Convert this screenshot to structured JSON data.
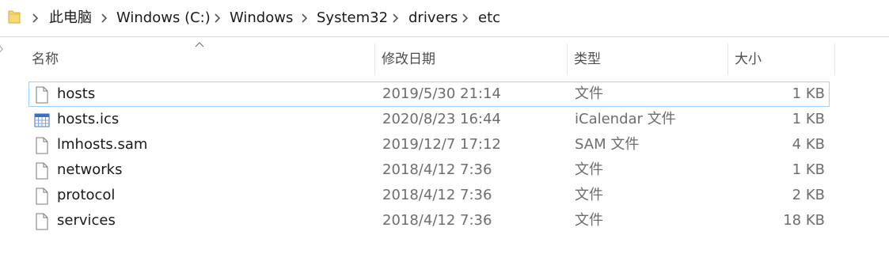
{
  "breadcrumb": {
    "items": [
      {
        "label": "此电脑"
      },
      {
        "label": "Windows (C:)"
      },
      {
        "label": "Windows"
      },
      {
        "label": "System32"
      },
      {
        "label": "drivers"
      },
      {
        "label": "etc"
      }
    ]
  },
  "columns": {
    "name": "名称",
    "date": "修改日期",
    "type": "类型",
    "size": "大小",
    "sort_indicator": "sort-ascending-icon"
  },
  "files": [
    {
      "name": "hosts",
      "modified": "2019/5/30 21:14",
      "type": "文件",
      "size": "1 KB",
      "icon": "document-icon",
      "focused": true
    },
    {
      "name": "hosts.ics",
      "modified": "2020/8/23 16:44",
      "type": "iCalendar 文件",
      "size": "1 KB",
      "icon": "calendar-file-icon",
      "focused": false
    },
    {
      "name": "lmhosts.sam",
      "modified": "2019/12/7 17:12",
      "type": "SAM 文件",
      "size": "4 KB",
      "icon": "document-icon",
      "focused": false
    },
    {
      "name": "networks",
      "modified": "2018/4/12 7:36",
      "type": "文件",
      "size": "1 KB",
      "icon": "document-icon",
      "focused": false
    },
    {
      "name": "protocol",
      "modified": "2018/4/12 7:36",
      "type": "文件",
      "size": "2 KB",
      "icon": "document-icon",
      "focused": false
    },
    {
      "name": "services",
      "modified": "2018/4/12 7:36",
      "type": "文件",
      "size": "18 KB",
      "icon": "document-icon",
      "focused": false
    }
  ],
  "colors": {
    "focus_border": "#99d1ff",
    "folder_yellow": "#f8d775",
    "header_text": "#4d4d4d",
    "secondary_text": "#6d6d6d"
  }
}
